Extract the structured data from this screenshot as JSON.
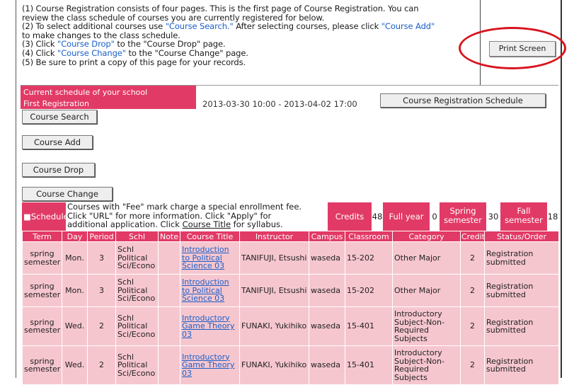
{
  "instructions": [
    {
      "parts": [
        {
          "t": "(1) Course Registration consists of four pages. This is the first page of Course Registration. You can"
        }
      ]
    },
    {
      "parts": [
        {
          "t": "review the class schedule of courses you are currently registered for below."
        }
      ]
    },
    {
      "parts": [
        {
          "t": "(2) To select additional courses use "
        },
        {
          "t": "\"Course Search.\"",
          "link": true
        },
        {
          "t": " After selecting courses, please click "
        },
        {
          "t": "\"Course Add\"",
          "link": true
        }
      ]
    },
    {
      "parts": [
        {
          "t": "to make changes to the class schedule."
        }
      ]
    },
    {
      "parts": [
        {
          "t": "(3) Click "
        },
        {
          "t": "\"Course Drop\"",
          "link": true
        },
        {
          "t": " to the \"Course Drop\" page."
        }
      ]
    },
    {
      "parts": [
        {
          "t": "(4) Click "
        },
        {
          "t": "\"Course Change\"",
          "link": true
        },
        {
          "t": " to the \"Course Change\" page."
        }
      ]
    },
    {
      "parts": [
        {
          "t": "(5) Be sure to print a copy of this page for your records."
        }
      ]
    }
  ],
  "print_button": "Print Screen",
  "schedule_bar": {
    "label_line1": "Current schedule of your school",
    "label_line2": "First Registration",
    "dates": "2013-03-30 10:00 - 2013-04-02 17:00",
    "schedule_button": "Course Registration Schedule"
  },
  "buttons": {
    "search": "Course Search",
    "add": "Course Add",
    "drop": "Course Drop",
    "change": "Course Change"
  },
  "info": {
    "schedule_label": "■Schedule",
    "fee_line1": "Courses with \"Fee\" mark charge a special enrollment fee.",
    "fee_line2": "Click \"URL\" for more information. Click \"Apply\" for",
    "fee_line3_a": "additional application. Click ",
    "fee_line3_link": "Course Title",
    "fee_line3_b": " for syllabus.",
    "credits_label": "Credits",
    "credits_value": "48",
    "fullyear_label": "Full year",
    "fullyear_value": "0",
    "spring_label": "Spring semester",
    "spring_value": "30",
    "fall_label": "Fall semester",
    "fall_value": "18"
  },
  "table": {
    "headers": [
      "Term",
      "Day",
      "Period",
      "Schl",
      "Note",
      "Course Title",
      "Instructor",
      "Campus",
      "Classroom",
      "Category",
      "Credit",
      "Status/Order"
    ],
    "rows": [
      {
        "term": "spring semester",
        "day": "Mon.",
        "period": "3",
        "schl": "Schl Political Sci/Econo",
        "note": "",
        "title": "Introduction to Political Science 03",
        "instructor": "TANIFUJI, Etsushi",
        "campus": "waseda",
        "classroom": "15-202",
        "category": "Other Major",
        "credit": "2",
        "status": "Registration submitted"
      },
      {
        "term": "spring semester",
        "day": "Mon.",
        "period": "3",
        "schl": "Schl Political Sci/Econo",
        "note": "",
        "title": "Introduction to Political Science 03",
        "instructor": "TANIFUJI, Etsushi",
        "campus": "waseda",
        "classroom": "15-202",
        "category": "Other Major",
        "credit": "2",
        "status": "Registration submitted"
      },
      {
        "term": "spring semester",
        "day": "Wed.",
        "period": "2",
        "schl": "Schl Political Sci/Econo",
        "note": "",
        "title": "Introductory Game Theory 03",
        "instructor": "FUNAKI, Yukihiko",
        "campus": "waseda",
        "classroom": "15-401",
        "category": "Introductory Subject-Non-Required Subjects",
        "credit": "2",
        "status": "Registration submitted"
      },
      {
        "term": "spring semester",
        "day": "Wed.",
        "period": "2",
        "schl": "Schl Political Sci/Econo",
        "note": "",
        "title": "Introductory Game Theory 03",
        "instructor": "FUNAKI, Yukihiko",
        "campus": "waseda",
        "classroom": "15-401",
        "category": "Introductory Subject-Non-Required Subjects",
        "credit": "2",
        "status": "Registration submitted"
      }
    ]
  },
  "colors": {
    "accent_red": "#e23a66",
    "row_pink": "#f6c6cf",
    "link_blue": "#1a5fc8",
    "highlight_oval": "#d8141e"
  }
}
